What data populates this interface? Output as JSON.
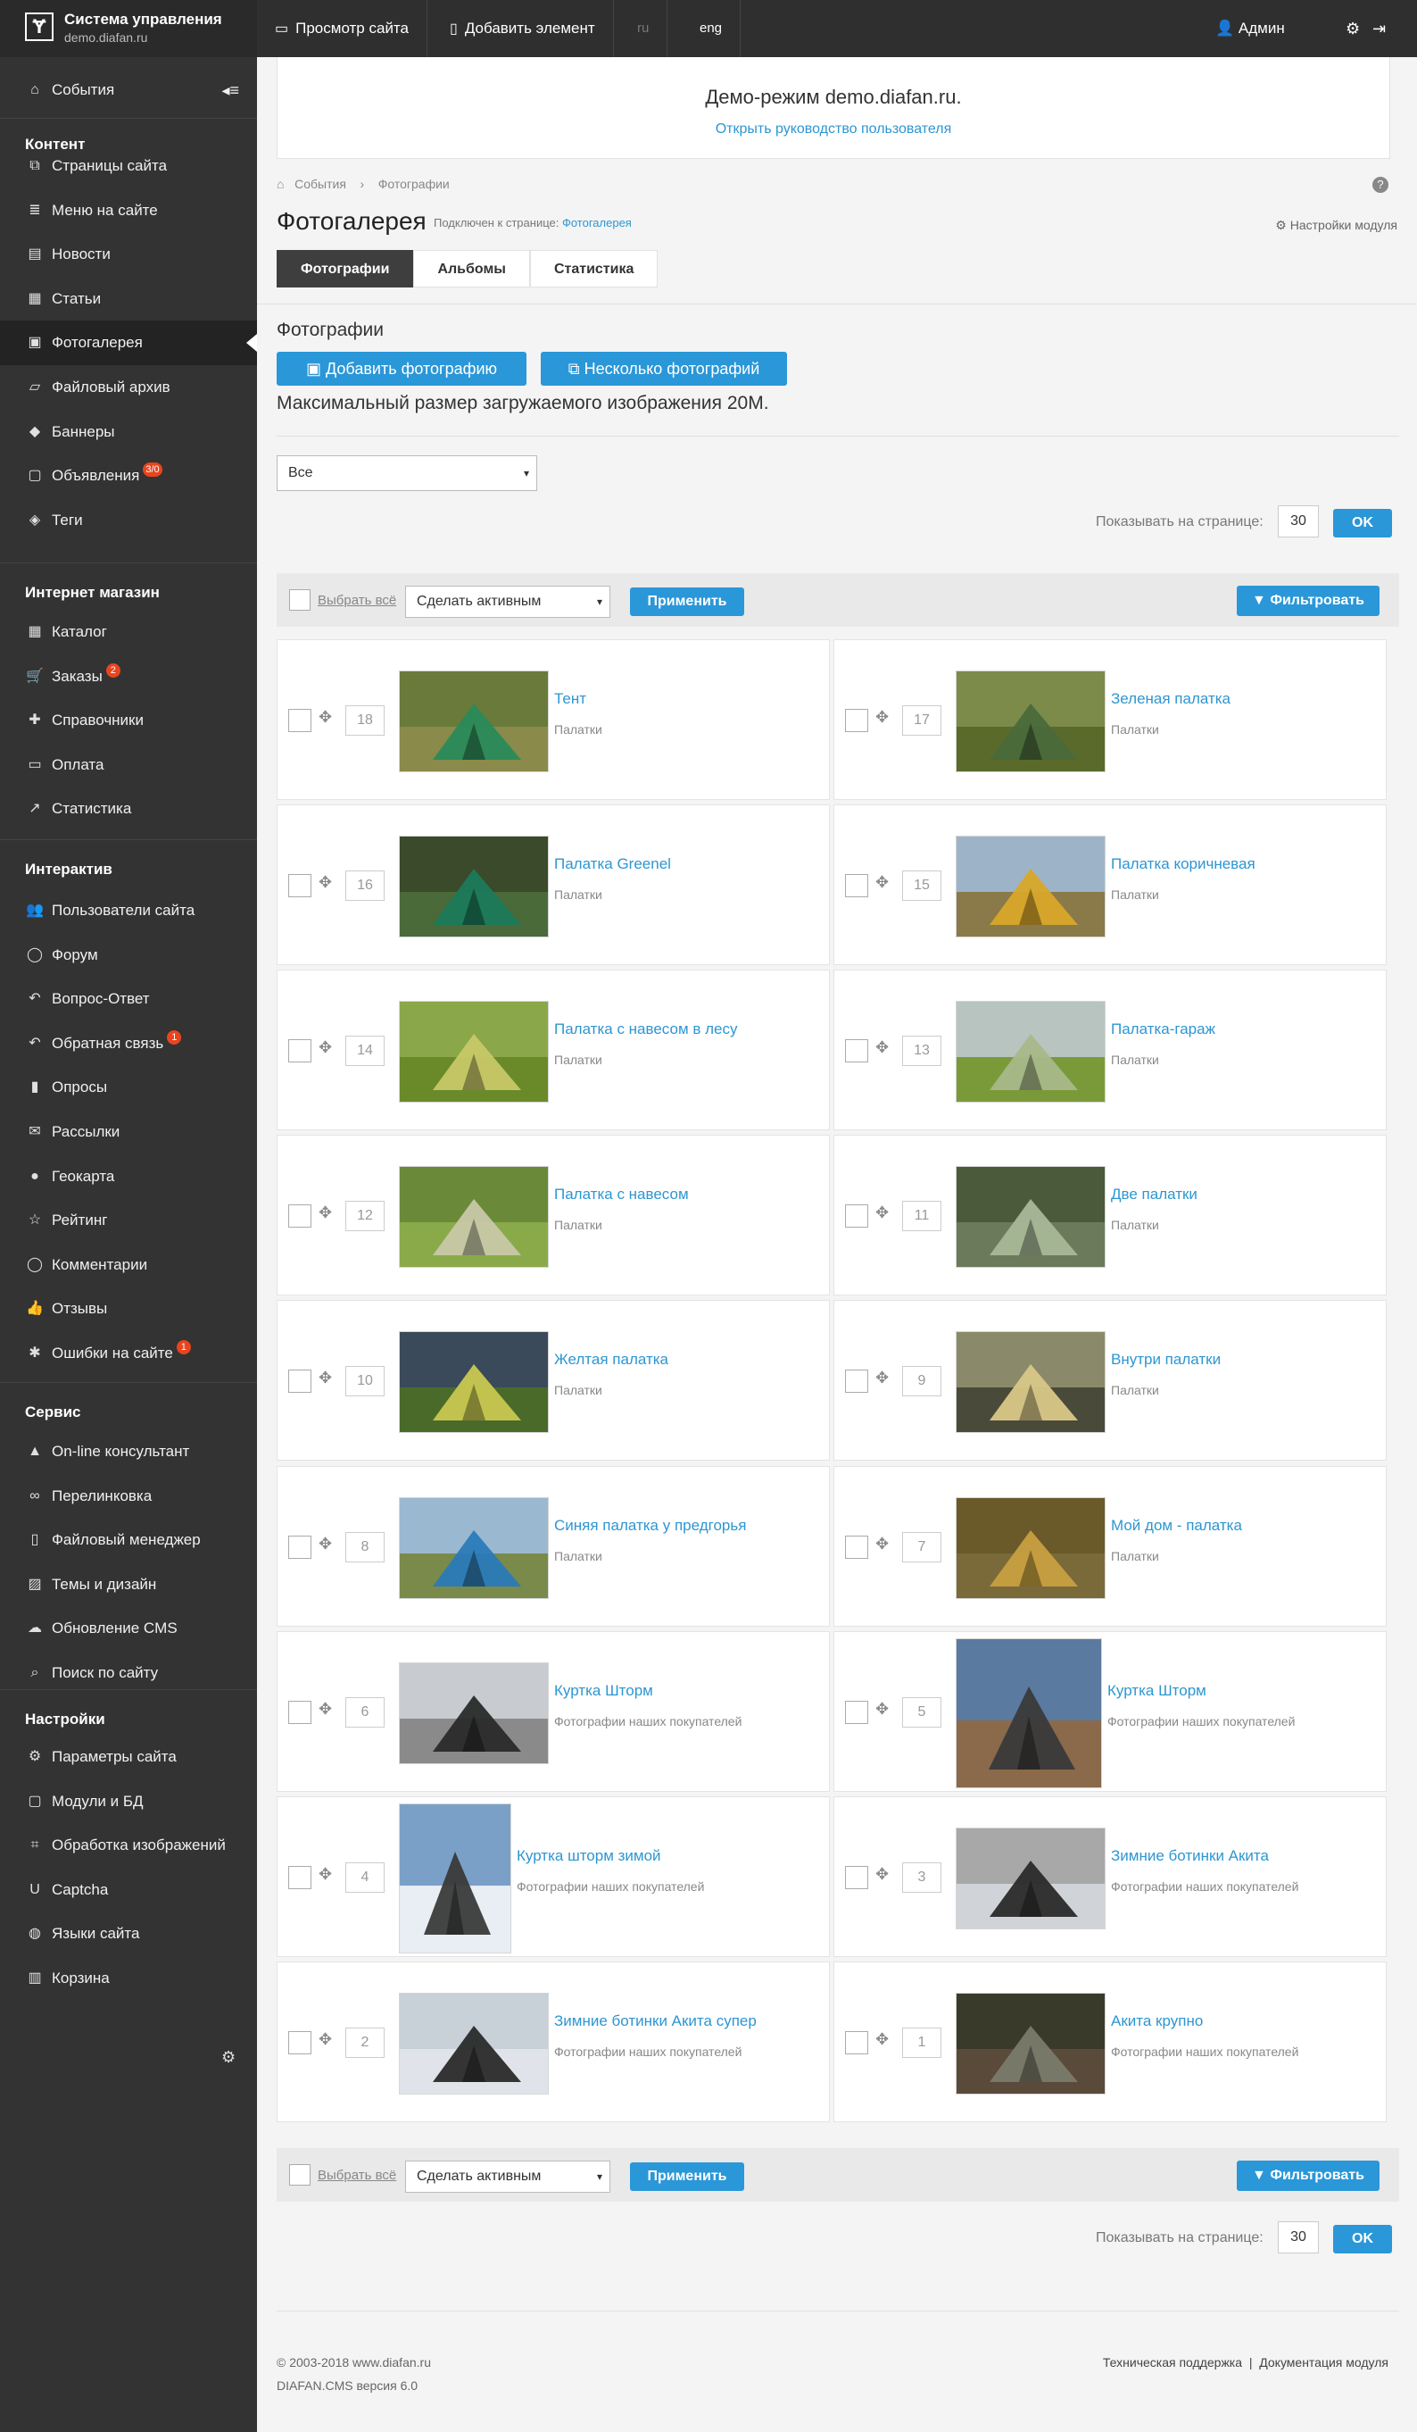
{
  "topbar": {
    "title": "Система управления",
    "subtitle": "demo.diafan.ru",
    "view_site": "Просмотр сайта",
    "add_element": "Добавить элемент",
    "lang_ru": "ru",
    "lang_eng": "eng",
    "user": "Админ"
  },
  "sidebar": {
    "events": "События",
    "sections": [
      {
        "title": "Контент",
        "items": [
          {
            "label": "Страницы сайта",
            "icon": "pages-icon"
          },
          {
            "label": "Меню на сайте",
            "icon": "menu-icon"
          },
          {
            "label": "Новости",
            "icon": "news-icon"
          },
          {
            "label": "Статьи",
            "icon": "articles-icon"
          },
          {
            "label": "Фотогалерея",
            "icon": "photo-icon",
            "active": true
          },
          {
            "label": "Файловый архив",
            "icon": "folder-icon"
          },
          {
            "label": "Баннеры",
            "icon": "banner-icon"
          },
          {
            "label": "Объявления",
            "icon": "ads-icon",
            "badge": "3/0"
          },
          {
            "label": "Теги",
            "icon": "tags-icon"
          }
        ]
      },
      {
        "title": "Интернет магазин",
        "items": [
          {
            "label": "Каталог",
            "icon": "catalog-icon"
          },
          {
            "label": "Заказы",
            "icon": "cart-icon",
            "badge": "2"
          },
          {
            "label": "Справочники",
            "icon": "puzzle-icon"
          },
          {
            "label": "Оплата",
            "icon": "card-icon"
          },
          {
            "label": "Статистика",
            "icon": "stats-icon"
          }
        ]
      },
      {
        "title": "Интерактив",
        "items": [
          {
            "label": "Пользователи сайта",
            "icon": "users-icon"
          },
          {
            "label": "Форум",
            "icon": "forum-icon"
          },
          {
            "label": "Вопрос-Ответ",
            "icon": "reply-icon"
          },
          {
            "label": "Обратная связь",
            "icon": "feedback-icon",
            "badge": "1"
          },
          {
            "label": "Опросы",
            "icon": "poll-icon"
          },
          {
            "label": "Рассылки",
            "icon": "mail-icon"
          },
          {
            "label": "Геокарта",
            "icon": "marker-icon"
          },
          {
            "label": "Рейтинг",
            "icon": "star-icon"
          },
          {
            "label": "Комментарии",
            "icon": "comment-icon"
          },
          {
            "label": "Отзывы",
            "icon": "thumb-icon"
          },
          {
            "label": "Ошибки на сайте",
            "icon": "bug-icon",
            "badge": "1"
          }
        ]
      },
      {
        "title": "Сервис",
        "items": [
          {
            "label": "On-line консультант",
            "icon": "graduation-icon"
          },
          {
            "label": "Перелинковка",
            "icon": "link-icon"
          },
          {
            "label": "Файловый менеджер",
            "icon": "file-icon"
          },
          {
            "label": "Темы и дизайн",
            "icon": "theme-icon"
          },
          {
            "label": "Обновление CMS",
            "icon": "cloud-icon"
          },
          {
            "label": "Поиск по сайту",
            "icon": "search-icon"
          }
        ]
      },
      {
        "title": "Настройки",
        "items": [
          {
            "label": "Параметры сайта",
            "icon": "gears-icon"
          },
          {
            "label": "Модули и БД",
            "icon": "module-icon"
          },
          {
            "label": "Обработка изображений",
            "icon": "crop-icon"
          },
          {
            "label": "Captcha",
            "icon": "captcha-icon"
          },
          {
            "label": "Языки сайта",
            "icon": "globe-icon"
          },
          {
            "label": "Корзина",
            "icon": "trash-icon"
          }
        ]
      }
    ]
  },
  "demo": {
    "line1": "Демо-режим demo.diafan.ru.",
    "line2": "Открыть руководство пользователя"
  },
  "breadcrumb": {
    "home": "События",
    "sep": "›",
    "current": "Фотографии"
  },
  "page": {
    "title": "Фотогалерея",
    "connected_label": "Подключен к странице:",
    "connected_link": "Фотогалерея",
    "module_settings": "Настройки модуля"
  },
  "tabs": [
    {
      "label": "Фотографии",
      "active": true
    },
    {
      "label": "Альбомы"
    },
    {
      "label": "Статистика"
    }
  ],
  "photos_section": {
    "heading": "Фотографии",
    "add_photo": "Добавить фотографию",
    "add_multiple": "Несколько фотографий",
    "max_size": "Максимальный размер загружаемого изображения 20M."
  },
  "album_filter": {
    "selected": "Все"
  },
  "pagination": {
    "label": "Показывать на странице:",
    "value": "30",
    "ok": "OK"
  },
  "group_action": {
    "select_all": "Выбрать всё",
    "action_selected": "Сделать активным",
    "apply": "Применить",
    "filter": "Фильтровать"
  },
  "items": [
    {
      "num": "18",
      "title": "Тент",
      "album": "Палатки",
      "scene": "tent-green"
    },
    {
      "num": "17",
      "title": "Зеленая палатка",
      "album": "Палатки",
      "scene": "field-dark"
    },
    {
      "num": "16",
      "title": "Палатка Greenel",
      "album": "Палатки",
      "scene": "tent-dome"
    },
    {
      "num": "15",
      "title": "Палатка коричневая",
      "album": "Палатки",
      "scene": "mountain"
    },
    {
      "num": "14",
      "title": "Палатка с навесом в лесу",
      "album": "Палатки",
      "scene": "forest"
    },
    {
      "num": "13",
      "title": "Палатка-гараж",
      "album": "Палатки",
      "scene": "car"
    },
    {
      "num": "12",
      "title": "Палатка с навесом",
      "album": "Палатки",
      "scene": "meadow"
    },
    {
      "num": "11",
      "title": "Две палатки",
      "album": "Палатки",
      "scene": "two"
    },
    {
      "num": "10",
      "title": "Желтая палатка",
      "album": "Палатки",
      "scene": "lake"
    },
    {
      "num": "9",
      "title": "Внутри палатки",
      "album": "Палатки",
      "scene": "inside"
    },
    {
      "num": "8",
      "title": "Синяя палатка у предгорья",
      "album": "Палатки",
      "scene": "blue"
    },
    {
      "num": "7",
      "title": "Мой дом - палатка",
      "album": "Палатки",
      "scene": "gold"
    },
    {
      "num": "6",
      "title": "Куртка Шторм",
      "album": "Фотографии наших покупателей",
      "scene": "winter-mist"
    },
    {
      "num": "5",
      "title": "Куртка Шторм",
      "album": "Фотографии наших покупателей",
      "scene": "rock"
    },
    {
      "num": "4",
      "title": "Куртка шторм зимой",
      "album": "Фотографии наших покупателей",
      "scene": "snow-person"
    },
    {
      "num": "3",
      "title": "Зимние ботинки Акита",
      "album": "Фотографии наших покупателей",
      "scene": "ice"
    },
    {
      "num": "2",
      "title": "Зимние ботинки Акита супер",
      "album": "Фотографии наших покупателей",
      "scene": "snow-arms"
    },
    {
      "num": "1",
      "title": "Акита крупно",
      "album": "Фотографии наших покупателей",
      "scene": "boots"
    }
  ],
  "footer": {
    "copyright": "© 2003-2018 www.diafan.ru",
    "version": "DIAFAN.CMS версия 6.0",
    "support": "Техническая поддержка",
    "sep": "|",
    "docs": "Документация модуля"
  }
}
